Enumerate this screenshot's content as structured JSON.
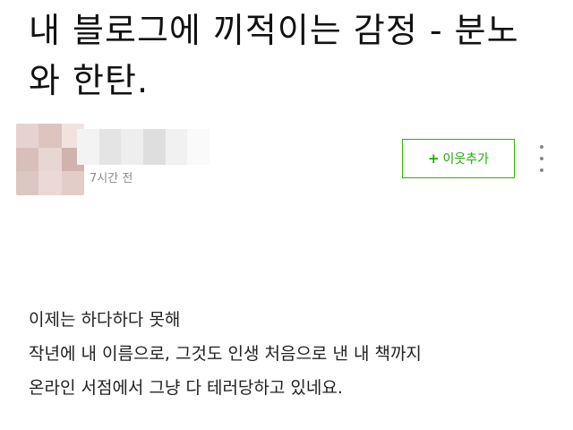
{
  "post": {
    "title": "내 블로그에 끼적이는 감정 - 분노와 한탄.",
    "author": {
      "time_ago": "7시간 전"
    },
    "actions": {
      "add_neighbor_icon": "plus-icon",
      "add_neighbor_label": "이웃추가",
      "more_icon": "vertical-ellipsis-icon"
    },
    "body_lines": [
      "이제는 하다하다 못해",
      "작년에 내 이름으로, 그것도 인생 처음으로 낸 내 책까지",
      "온라인 서점에서 그냥 다 테러당하고 있네요."
    ]
  },
  "colors": {
    "accent": "#2db400",
    "meta_text": "#8a8a8a",
    "body_text": "#222222"
  }
}
